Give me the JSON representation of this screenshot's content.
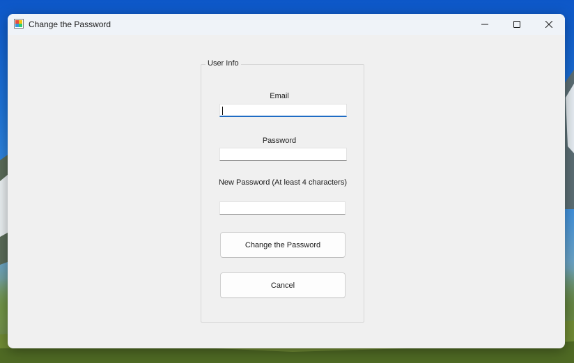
{
  "window": {
    "title": "Change the Password",
    "controls": {
      "minimize": "minimize-icon",
      "maximize": "maximize-icon",
      "close": "close-icon"
    }
  },
  "group": {
    "legend": "User Info"
  },
  "form": {
    "email_label": "Email",
    "email_value": "",
    "password_label": "Password",
    "password_value": "",
    "new_password_label": "New Password (At least 4 characters)",
    "new_password_value": "",
    "submit_label": "Change the Password",
    "cancel_label": "Cancel"
  },
  "colors": {
    "focus_accent": "#1f6cc4",
    "window_background": "#f0f0f0"
  }
}
